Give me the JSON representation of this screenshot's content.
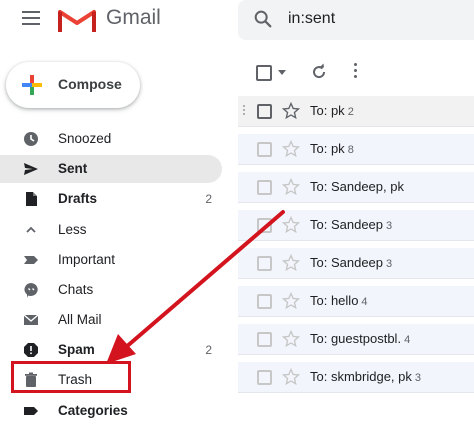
{
  "header": {
    "brand": "Gmail",
    "search_value": "in:sent"
  },
  "compose": {
    "label": "Compose"
  },
  "sidebar": {
    "items": [
      {
        "label": "Snoozed",
        "count": "",
        "bold": false,
        "icon": "clock-icon"
      },
      {
        "label": "Sent",
        "count": "",
        "bold": true,
        "icon": "send-icon",
        "active": true
      },
      {
        "label": "Drafts",
        "count": "2",
        "bold": true,
        "icon": "draft-icon"
      },
      {
        "label": "Less",
        "count": "",
        "bold": false,
        "icon": "chevron-up-icon"
      },
      {
        "label": "Important",
        "count": "",
        "bold": false,
        "icon": "important-icon"
      },
      {
        "label": "Chats",
        "count": "",
        "bold": false,
        "icon": "chat-icon"
      },
      {
        "label": "All Mail",
        "count": "",
        "bold": false,
        "icon": "mail-icon"
      },
      {
        "label": "Spam",
        "count": "2",
        "bold": true,
        "icon": "spam-icon"
      },
      {
        "label": "Trash",
        "count": "",
        "bold": false,
        "icon": "trash-icon"
      },
      {
        "label": "Categories",
        "count": "",
        "bold": true,
        "icon": "label-icon"
      }
    ]
  },
  "messages": [
    {
      "to": "To: pk",
      "count": "2"
    },
    {
      "to": "To: pk",
      "count": "8"
    },
    {
      "to": "To: Sandeep, pk",
      "count": ""
    },
    {
      "to": "To: Sandeep",
      "count": "3"
    },
    {
      "to": "To: Sandeep",
      "count": "3"
    },
    {
      "to": "To: hello",
      "count": "4"
    },
    {
      "to": "To: guestpostbl.",
      "count": "4"
    },
    {
      "to": "To: skmbridge, pk",
      "count": "3"
    }
  ],
  "colors": {
    "annotation_red": "#d3141f",
    "active_bg": "#e8e8e8",
    "list_bg": "#f2f6fc"
  }
}
